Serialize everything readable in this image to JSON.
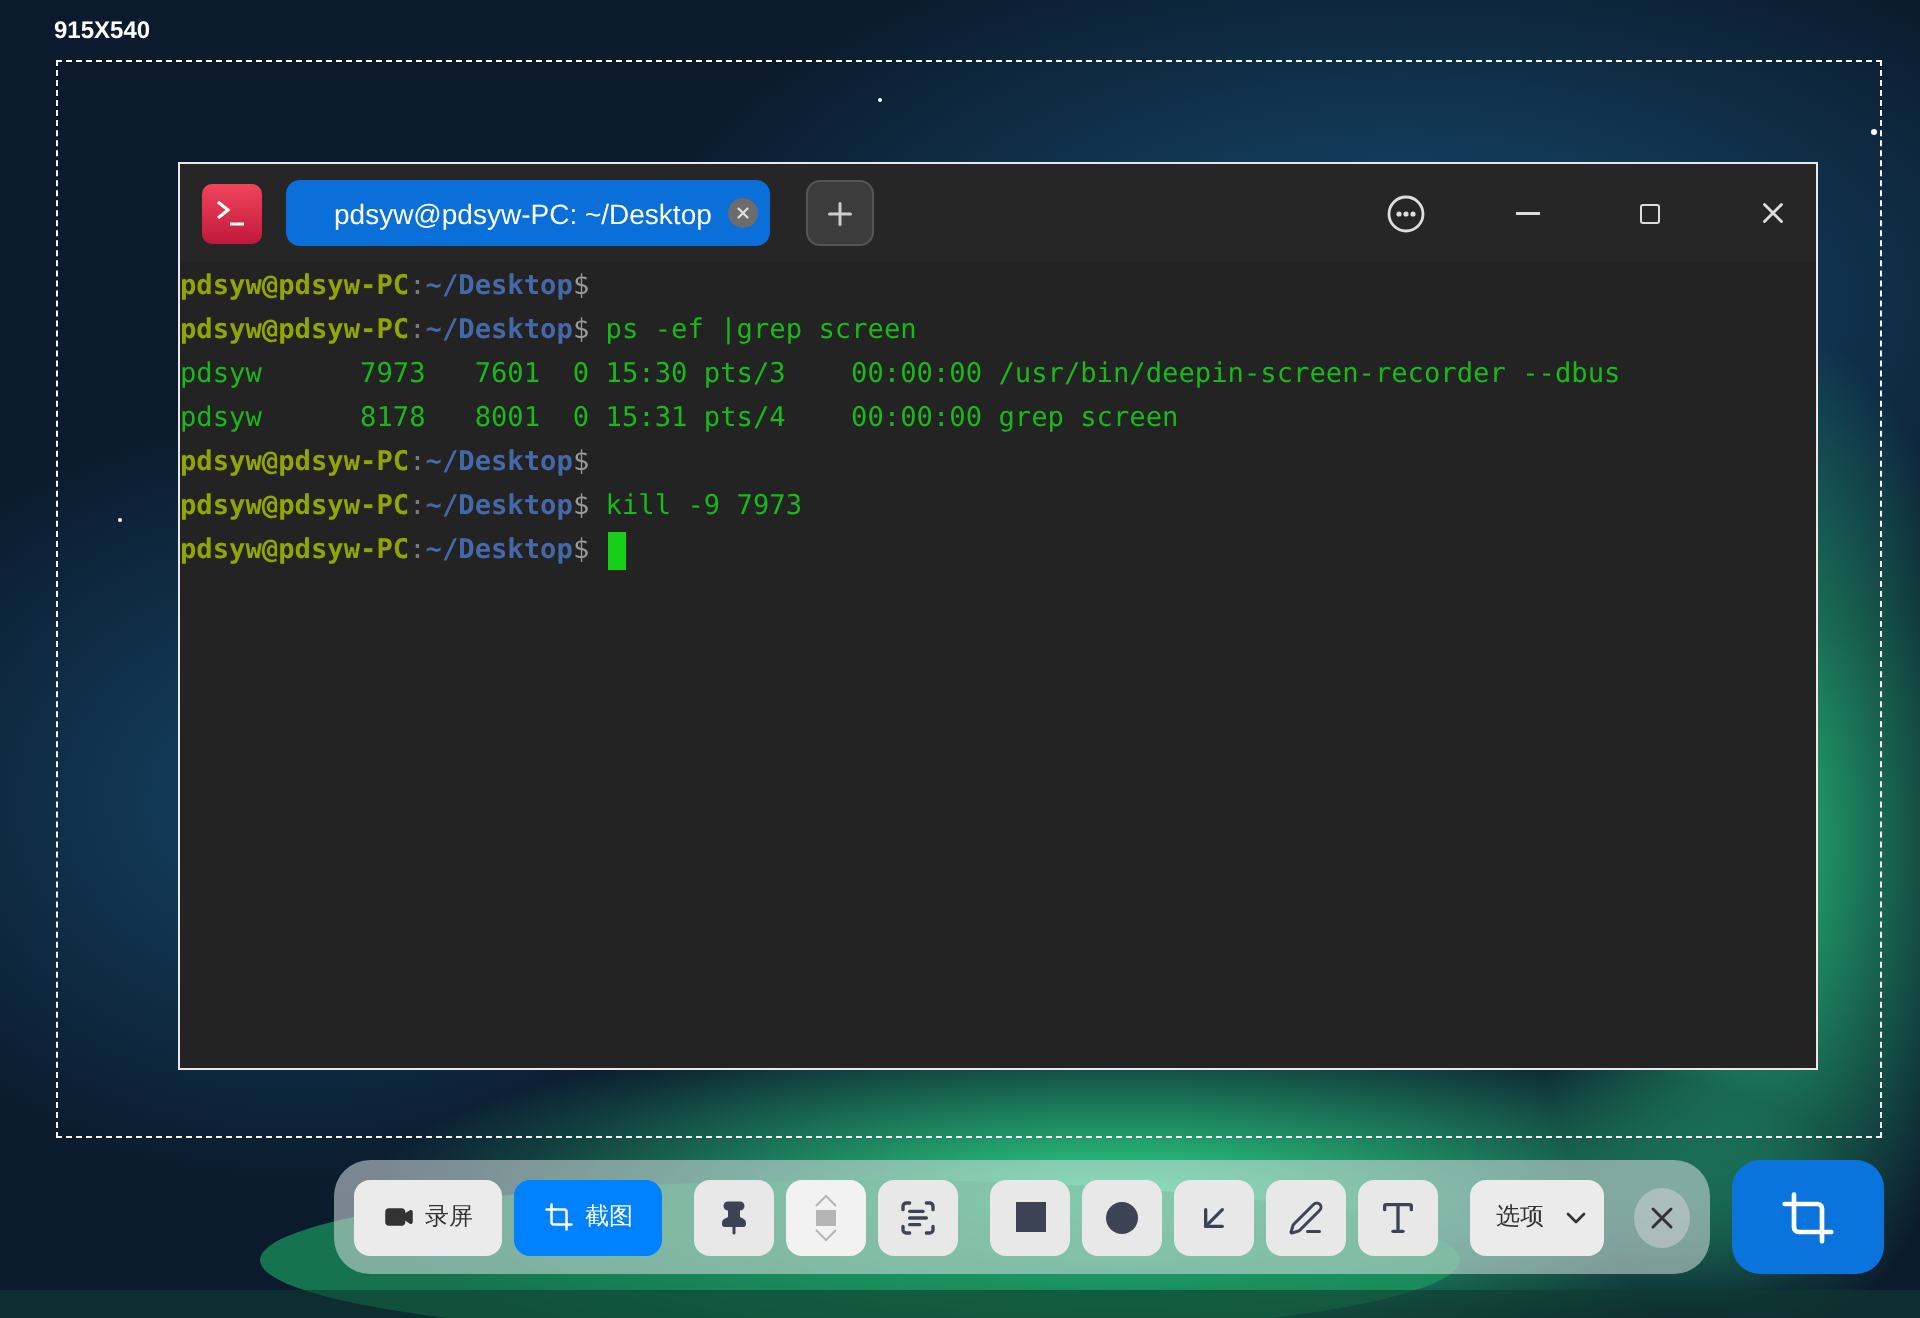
{
  "selection": {
    "size_label": "915X540"
  },
  "terminal": {
    "tab_title": "pdsyw@pdsyw-PC: ~/Desktop",
    "lines": [
      {
        "kind": "prompt",
        "user": "pdsyw@pdsyw-PC",
        "sep": ":",
        "path": "~/Desktop",
        "symbol": "$",
        "cursor": false
      },
      {
        "kind": "prompt",
        "user": "pdsyw@pdsyw-PC",
        "sep": ":",
        "path": "~/Desktop",
        "symbol": "$",
        "command": " ps -ef |grep screen",
        "cursor": false
      },
      {
        "kind": "output",
        "text": "pdsyw      7973   7601  0 15:30 pts/3    00:00:00 /usr/bin/deepin-screen-recorder --dbus"
      },
      {
        "kind": "output",
        "text": "pdsyw      8178   8001  0 15:31 pts/4    00:00:00 grep screen"
      },
      {
        "kind": "prompt",
        "user": "pdsyw@pdsyw-PC",
        "sep": ":",
        "path": "~/Desktop",
        "symbol": "$",
        "cursor": false
      },
      {
        "kind": "prompt",
        "user": "pdsyw@pdsyw-PC",
        "sep": ":",
        "path": "~/Desktop",
        "symbol": "$",
        "command": " kill -9 7973",
        "cursor": false
      },
      {
        "kind": "prompt",
        "user": "pdsyw@pdsyw-PC",
        "sep": ":",
        "path": "~/Desktop",
        "symbol": "$",
        "cursor": true
      }
    ]
  },
  "toolbar": {
    "modes": [
      {
        "kind": "record",
        "label": "录屏",
        "selected": false
      },
      {
        "kind": "screenshot",
        "label": "截图",
        "selected": true
      }
    ],
    "tools": [
      {
        "kind": "pin",
        "disabled": false
      },
      {
        "kind": "scroll",
        "disabled": true
      },
      {
        "kind": "ocr",
        "disabled": false
      },
      {
        "kind": "rect",
        "disabled": false
      },
      {
        "kind": "circle",
        "disabled": false
      },
      {
        "kind": "arrow",
        "disabled": false
      },
      {
        "kind": "pen",
        "disabled": false
      },
      {
        "kind": "text",
        "disabled": false
      }
    ],
    "options": {
      "label": "选项"
    }
  }
}
